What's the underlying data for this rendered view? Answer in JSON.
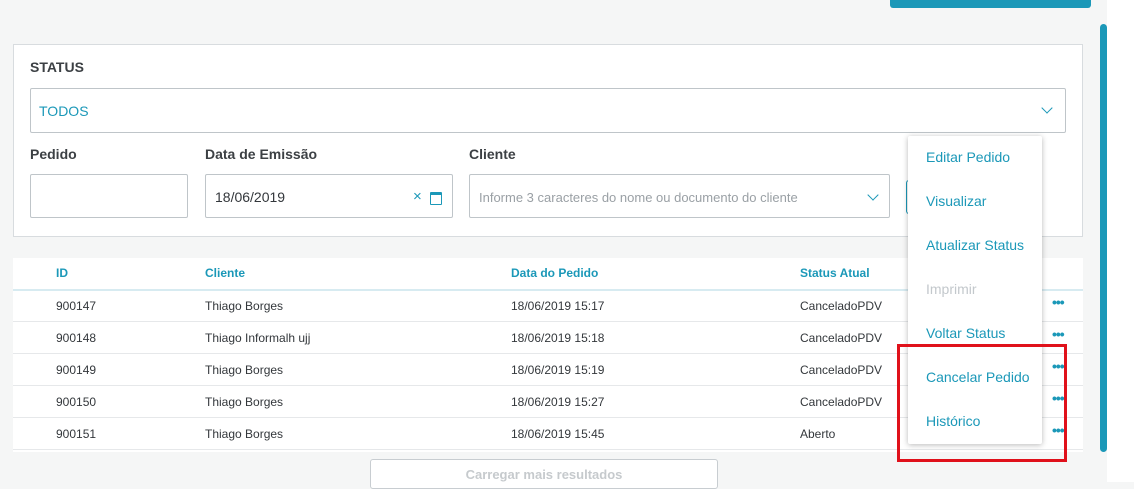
{
  "filters": {
    "status_label": "STATUS",
    "status_value": "TODOS",
    "pedido_label": "Pedido",
    "pedido_value": "",
    "data_label": "Data de Emissão",
    "data_value": "18/06/2019",
    "cliente_label": "Cliente",
    "cliente_placeholder": "Informe 3 caracteres do nome ou documento do cliente"
  },
  "table": {
    "columns": [
      "ID",
      "Cliente",
      "Data do Pedido",
      "Status Atual"
    ],
    "rows": [
      {
        "id": "900147",
        "cliente": "Thiago Borges",
        "data": "18/06/2019 15:17",
        "status": "CanceladoPDV"
      },
      {
        "id": "900148",
        "cliente": "Thiago Informalh ujj",
        "data": "18/06/2019 15:18",
        "status": "CanceladoPDV"
      },
      {
        "id": "900149",
        "cliente": "Thiago Borges",
        "data": "18/06/2019 15:19",
        "status": "CanceladoPDV"
      },
      {
        "id": "900150",
        "cliente": "Thiago Borges",
        "data": "18/06/2019 15:27",
        "status": "CanceladoPDV"
      },
      {
        "id": "900151",
        "cliente": "Thiago Borges",
        "data": "18/06/2019 15:45",
        "status": "Aberto"
      }
    ],
    "row_actions_icon": "more-horizontal-icon",
    "load_more_label": "Carregar mais resultados"
  },
  "context_menu": {
    "items": [
      {
        "label": "Editar Pedido",
        "enabled": true
      },
      {
        "label": "Visualizar",
        "enabled": true
      },
      {
        "label": "Atualizar Status",
        "enabled": true
      },
      {
        "label": "Imprimir",
        "enabled": false
      },
      {
        "label": "Voltar Status",
        "enabled": true
      },
      {
        "label": "Cancelar Pedido",
        "enabled": true
      },
      {
        "label": "Histórico",
        "enabled": true
      }
    ]
  },
  "colors": {
    "accent": "#1b98b8",
    "highlight": "#e0111b",
    "disabled": "#c3c8cc"
  }
}
